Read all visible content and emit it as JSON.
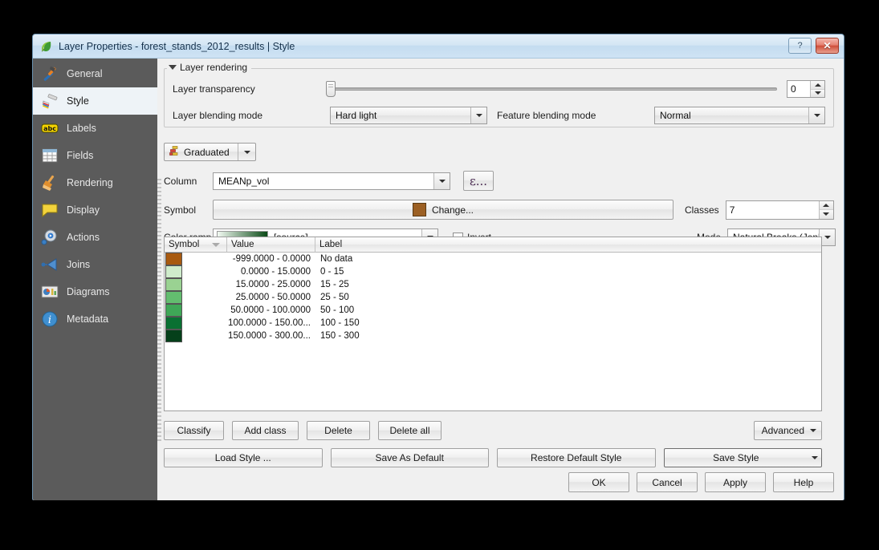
{
  "window": {
    "title": "Layer Properties - forest_stands_2012_results | Style",
    "icon": "qgis-leaf-icon",
    "help_btn": "?",
    "close_btn": "✕"
  },
  "sidebar": {
    "items": [
      {
        "label": "General",
        "icon": "hammer-wrench-icon",
        "active": false
      },
      {
        "label": "Style",
        "icon": "paintbrush-icon",
        "active": true
      },
      {
        "label": "Labels",
        "icon": "abc-label-icon",
        "active": false
      },
      {
        "label": "Fields",
        "icon": "table-grid-icon",
        "active": false
      },
      {
        "label": "Rendering",
        "icon": "broom-icon",
        "active": false
      },
      {
        "label": "Display",
        "icon": "speech-bubble-icon",
        "active": false
      },
      {
        "label": "Actions",
        "icon": "gear-play-icon",
        "active": false
      },
      {
        "label": "Joins",
        "icon": "join-arrow-icon",
        "active": false
      },
      {
        "label": "Diagrams",
        "icon": "chart-image-icon",
        "active": false
      },
      {
        "label": "Metadata",
        "icon": "info-circle-icon",
        "active": false
      }
    ]
  },
  "layer_rendering": {
    "group_title": "Layer rendering",
    "transparency_label": "Layer transparency",
    "transparency_value": "0",
    "layer_blending_label": "Layer blending mode",
    "layer_blending_value": "Hard light",
    "feature_blending_label": "Feature blending mode",
    "feature_blending_value": "Normal"
  },
  "style": {
    "renderer": "Graduated",
    "renderer_icon": "graduated-renderer-icon",
    "column_label": "Column",
    "column_value": "MEANp_vol",
    "expression_button": "ε...",
    "symbol_label": "Symbol",
    "symbol_change_button": "Change...",
    "symbol_color": "#9c6024",
    "classes_label": "Classes",
    "classes_value": "7",
    "color_ramp_label": "Color ramp",
    "color_ramp_value": "[source]",
    "color_ramp_start": "#f2faf2",
    "color_ramp_end": "#0b4a17",
    "invert_label": "Invert",
    "invert_checked": false,
    "mode_label": "Mode",
    "mode_value": "Natural Breaks (Jenks)"
  },
  "table": {
    "columns": [
      "Symbol",
      "Value",
      "Label"
    ],
    "sorted_column": "Symbol",
    "rows": [
      {
        "color": "#a85a10",
        "value": "-999.0000 - 0.0000",
        "label": "No data"
      },
      {
        "color": "#cfeccb",
        "value": "0.0000 - 15.0000",
        "label": "0 - 15"
      },
      {
        "color": "#9ad292",
        "value": "15.0000 - 25.0000",
        "label": "15 - 25"
      },
      {
        "color": "#63bd6f",
        "value": "25.0000 - 50.0000",
        "label": "25 - 50"
      },
      {
        "color": "#3fa757",
        "value": "50.0000 - 100.0000",
        "label": "50 - 100"
      },
      {
        "color": "#097032",
        "value": "100.0000 - 150.00...",
        "label": "100 - 150"
      },
      {
        "color": "#05401a",
        "value": "150.0000 - 300.00...",
        "label": "150 - 300"
      }
    ]
  },
  "class_actions": {
    "classify": "Classify",
    "add_class": "Add class",
    "delete": "Delete",
    "delete_all": "Delete all",
    "advanced": "Advanced"
  },
  "style_actions": {
    "load_style": "Load Style ...",
    "save_as_default": "Save As Default",
    "restore_default": "Restore Default Style",
    "save_style": "Save Style"
  },
  "dialog_buttons": {
    "ok": "OK",
    "cancel": "Cancel",
    "apply": "Apply",
    "help": "Help"
  }
}
